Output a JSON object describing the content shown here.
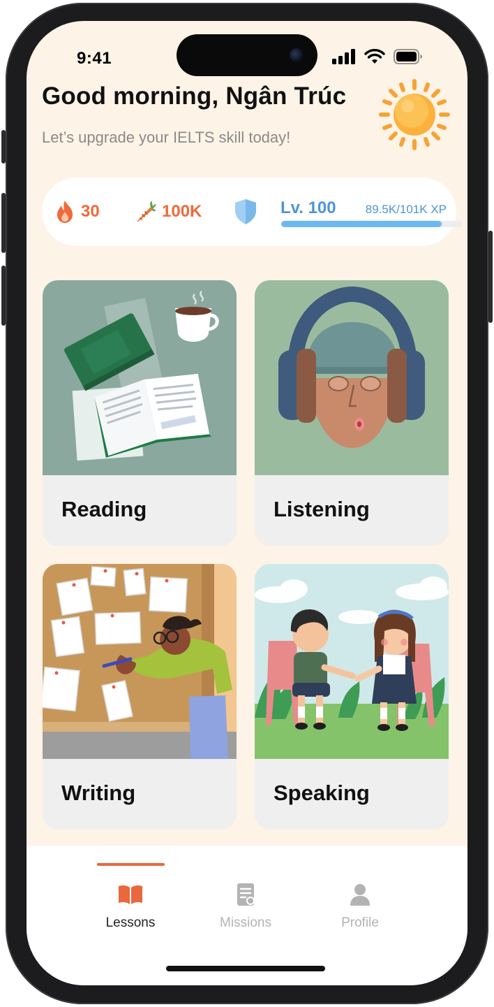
{
  "status_bar": {
    "time": "9:41"
  },
  "header": {
    "greeting": "Good morning, Ngân Trúc",
    "subtitle": "Let’s upgrade your IELTS skill today!"
  },
  "stats": {
    "streak_value": "30",
    "carrots_value": "100K",
    "level_label": "Lv. 100",
    "xp_label": "89.5K/101K XP",
    "xp_progress_fraction": 0.886
  },
  "skills": [
    {
      "label": "Reading",
      "icon": "reading-illustration"
    },
    {
      "label": "Listening",
      "icon": "listening-illustration"
    },
    {
      "label": "Writing",
      "icon": "writing-illustration"
    },
    {
      "label": "Speaking",
      "icon": "speaking-illustration"
    }
  ],
  "tabbar": {
    "tabs": [
      {
        "label": "Lessons",
        "icon": "book-icon",
        "active": true
      },
      {
        "label": "Missions",
        "icon": "document-icon",
        "active": false
      },
      {
        "label": "Profile",
        "icon": "person-icon",
        "active": false
      }
    ]
  },
  "colors": {
    "screen_background": "#fdf3e7",
    "accent_orange": "#e9683d",
    "level_blue": "#4d94d6",
    "inactive_tab": "#b3b3b3"
  }
}
